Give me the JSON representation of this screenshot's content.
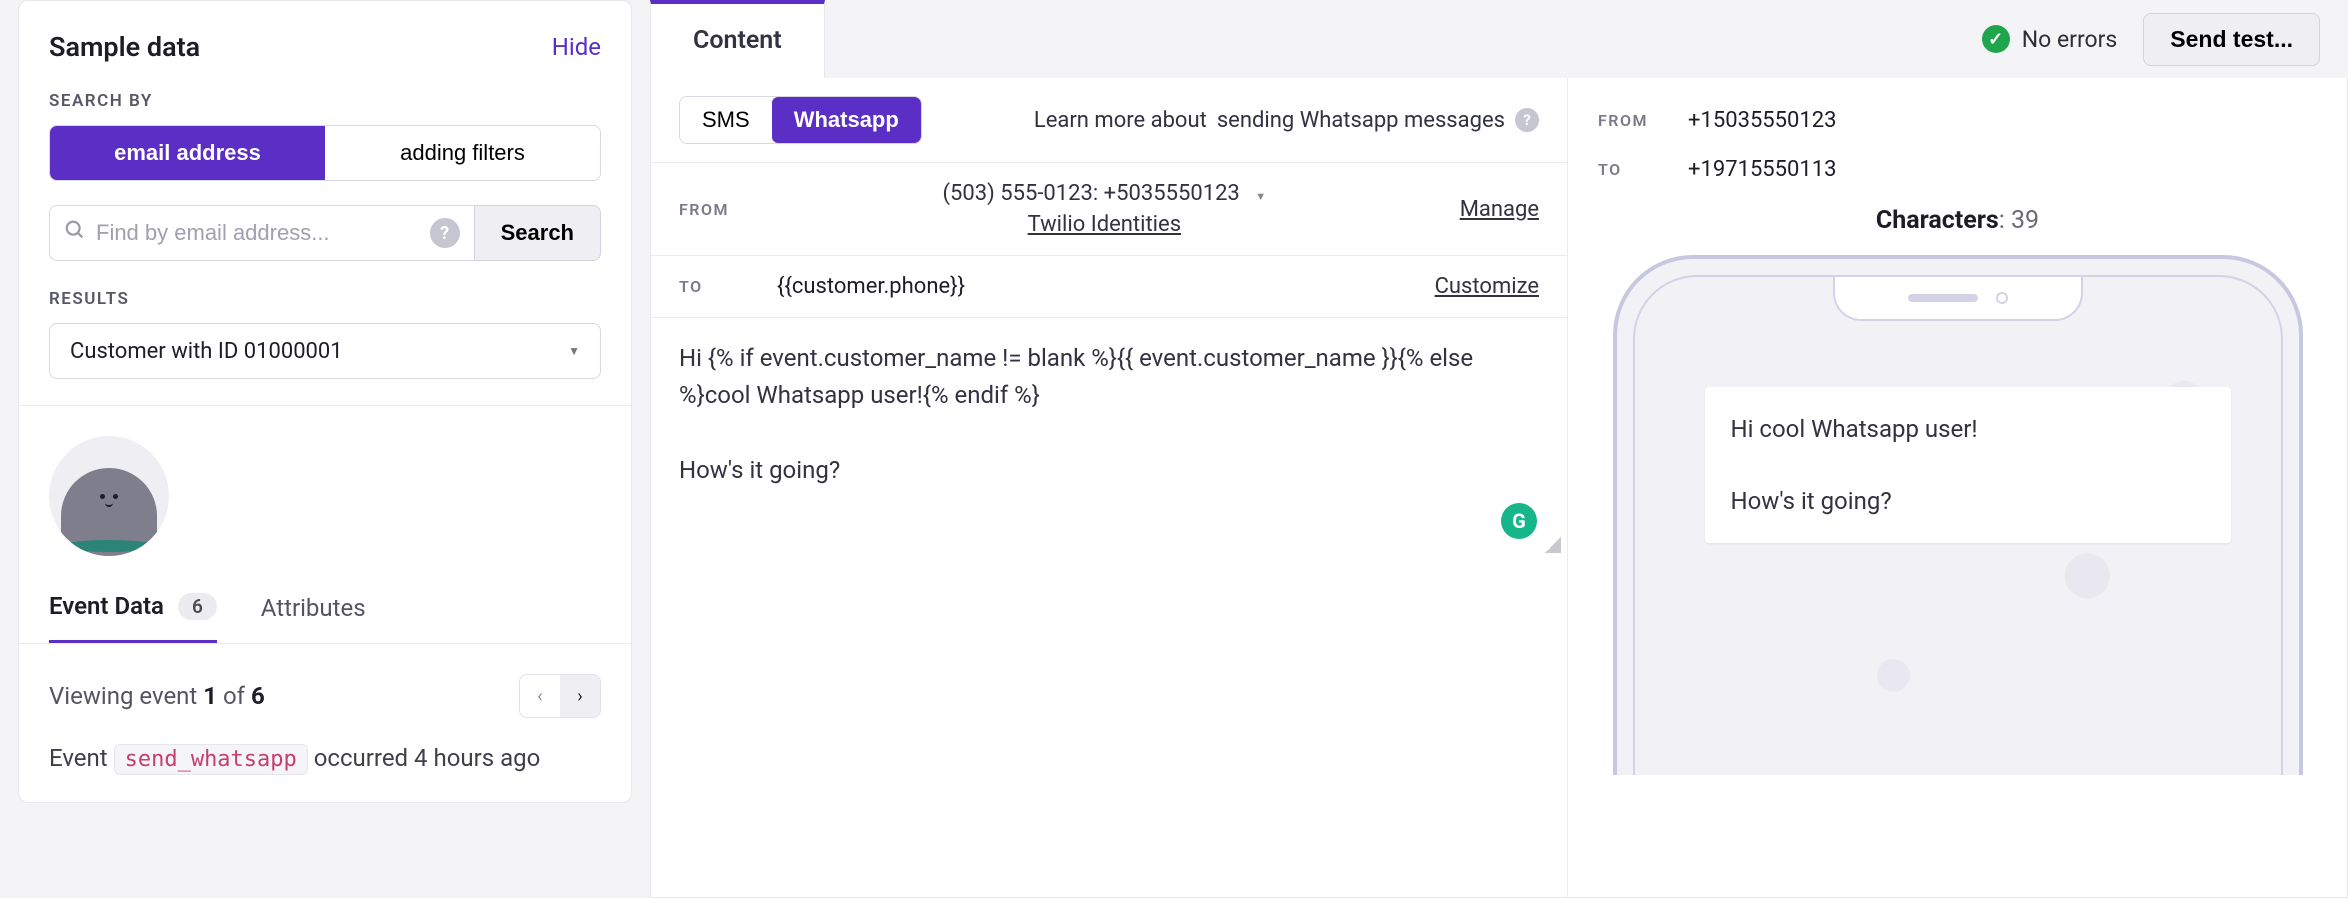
{
  "sidebar": {
    "title": "Sample data",
    "hide": "Hide",
    "search_by_label": "SEARCH BY",
    "seg": {
      "email": "email address",
      "filters": "adding filters"
    },
    "search_placeholder": "Find by email address...",
    "search_btn": "Search",
    "results_label": "RESULTS",
    "result_value": "Customer with ID 01000001",
    "tabs": {
      "event_data": "Event Data",
      "event_count": "6",
      "attributes": "Attributes"
    },
    "viewing_prefix": "Viewing event ",
    "viewing_num": "1",
    "viewing_of": " of ",
    "viewing_total": "6",
    "event_prefix": "Event ",
    "event_code": "send_whatsapp",
    "event_suffix": " occurred 4 hours ago"
  },
  "top": {
    "tab_content": "Content",
    "no_errors": "No errors",
    "send_test": "Send test..."
  },
  "editor": {
    "sms": "SMS",
    "whatsapp": "Whatsapp",
    "learn_prefix": "Learn more about ",
    "learn_link": "sending Whatsapp messages",
    "from_label": "FROM",
    "from_value": "(503) 555-0123: +5035550123",
    "from_sub": "Twilio Identities",
    "manage": "Manage",
    "to_label": "TO",
    "to_value": "{{customer.phone}}",
    "customize": "Customize",
    "body": "Hi {% if event.customer_name != blank %}{{ event.customer_name }}{% else %}cool Whatsapp user!{% endif %}\n\nHow's it going?"
  },
  "preview": {
    "from_label": "FROM",
    "from_value": "+15035550123",
    "to_label": "TO",
    "to_value": "+19715550113",
    "chars_label": "Characters",
    "chars_value": "39",
    "bubble": "Hi cool Whatsapp user!\n\nHow's it going?"
  }
}
